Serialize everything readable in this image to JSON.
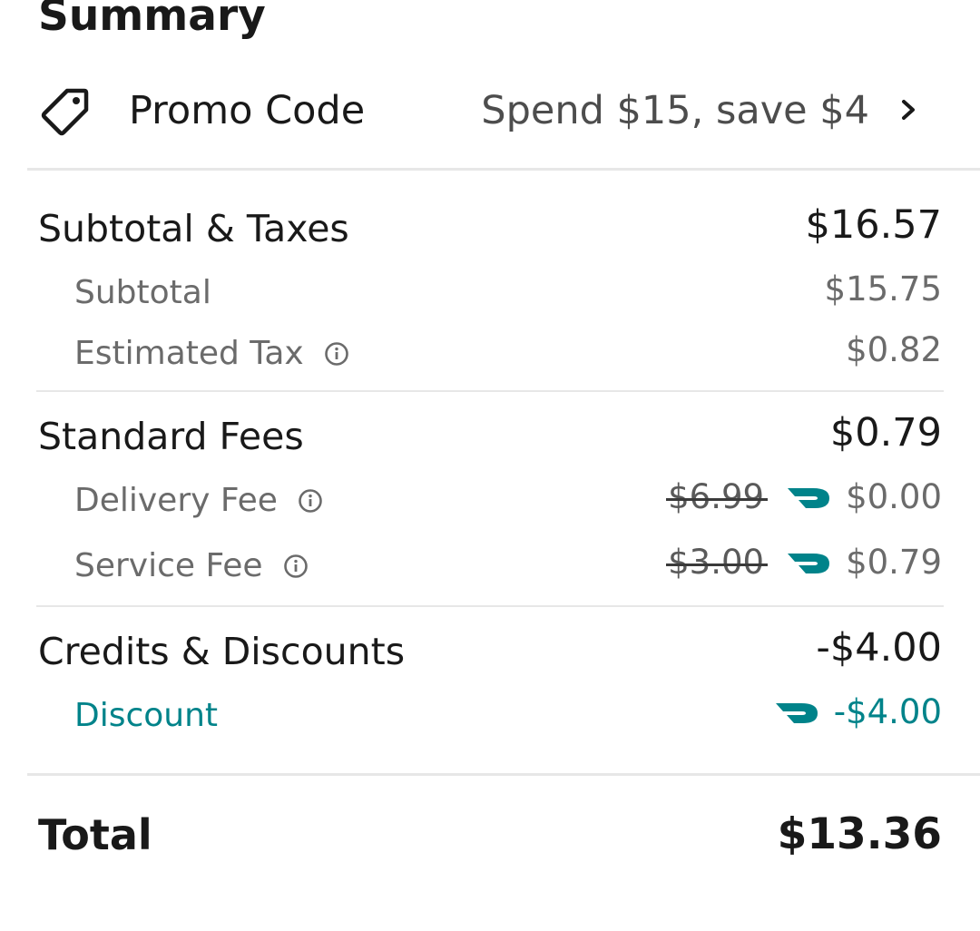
{
  "summary": {
    "title": "Summary"
  },
  "promo": {
    "label": "Promo Code",
    "value": "Spend $15, save $4",
    "icon": "tag-icon"
  },
  "subtotal_taxes": {
    "label": "Subtotal & Taxes",
    "value": "$16.57",
    "items": [
      {
        "label": "Subtotal",
        "value": "$15.75"
      },
      {
        "label": "Estimated Tax",
        "value": "$0.82",
        "has_info": true
      }
    ]
  },
  "standard_fees": {
    "label": "Standard Fees",
    "value": "$0.79",
    "items": [
      {
        "label": "Delivery Fee",
        "original": "$6.99",
        "value": "$0.00",
        "has_info": true,
        "dashpass": true
      },
      {
        "label": "Service Fee",
        "original": "$3.00",
        "value": "$0.79",
        "has_info": true,
        "dashpass": true
      }
    ]
  },
  "credits": {
    "label": "Credits & Discounts",
    "value": "-$4.00",
    "items": [
      {
        "label": "Discount",
        "value": "-$4.00",
        "dashpass": true
      }
    ]
  },
  "total": {
    "label": "Total",
    "value": "$13.36"
  },
  "colors": {
    "text_primary": "#191919",
    "text_secondary": "#6b6b6b",
    "accent_teal": "#00838a",
    "divider": "#e7e7e7"
  }
}
